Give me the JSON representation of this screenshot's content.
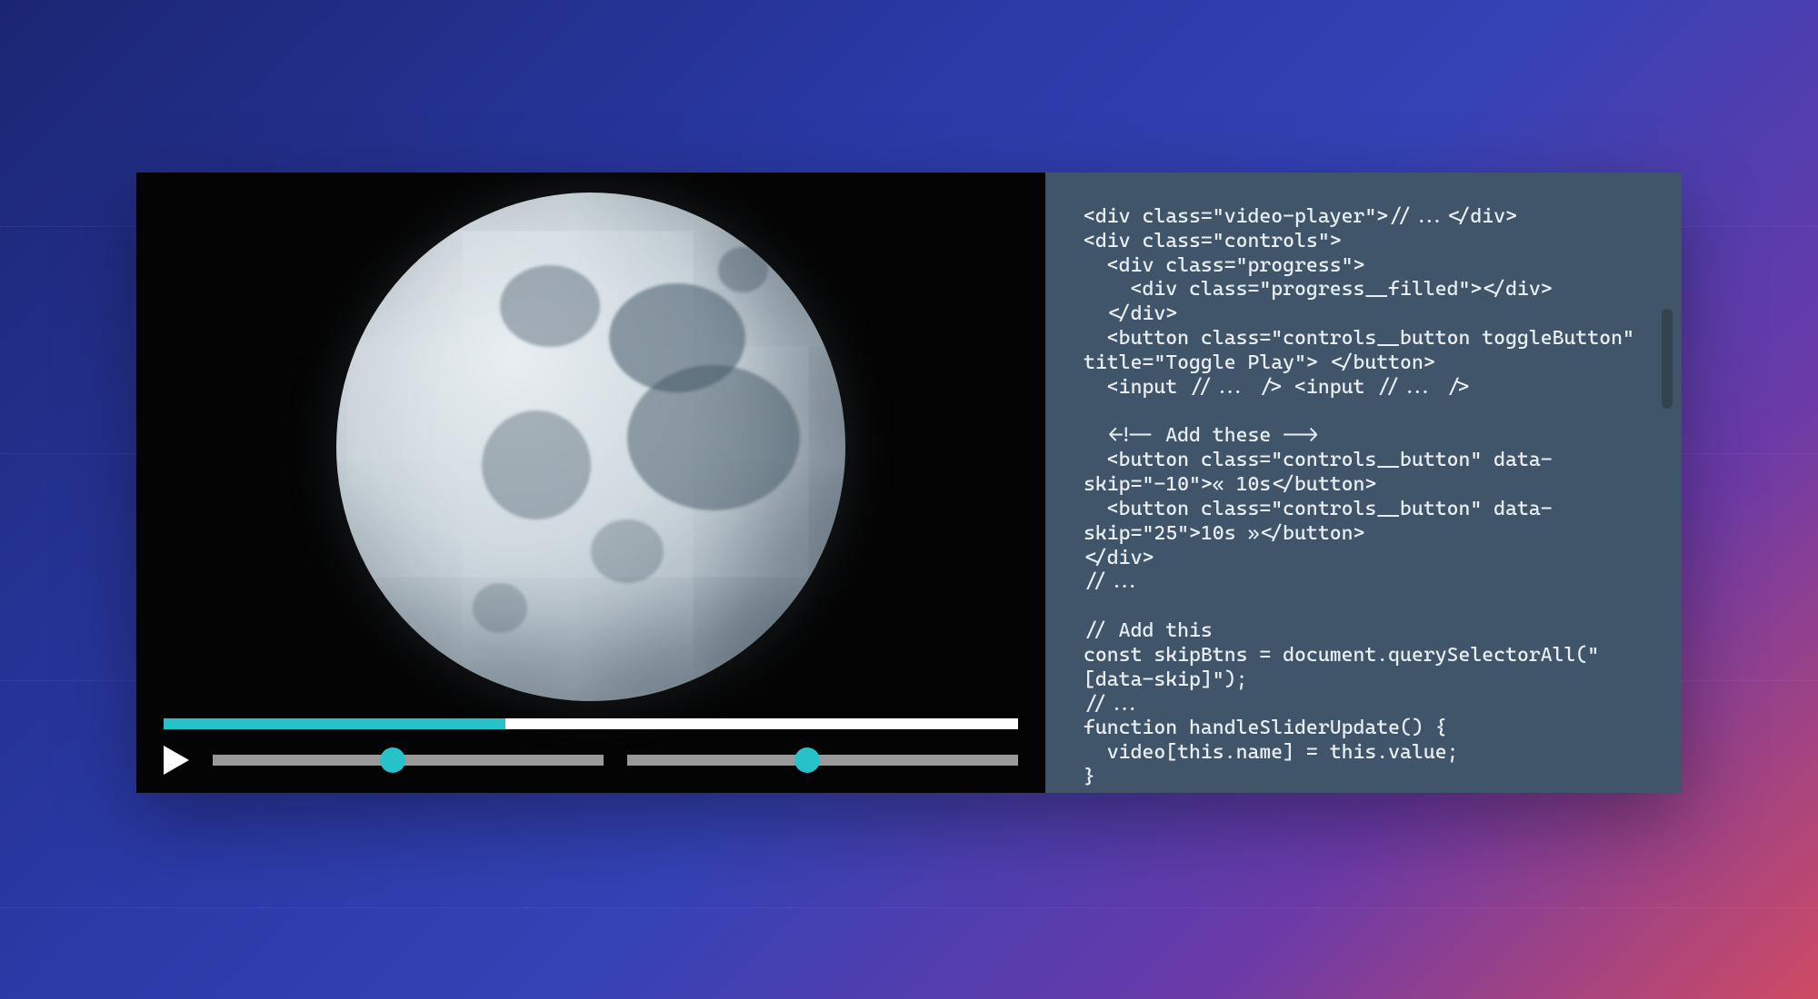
{
  "player": {
    "progress_percent": 40,
    "slider1_percent": 46,
    "slider2_percent": 46
  },
  "code": {
    "lines": [
      "<div class=\"video-player\">//...</div>",
      "<div class=\"controls\">",
      "  <div class=\"progress\">",
      "    <div class=\"progress__filled\"></div>",
      "  </div>",
      "  <button class=\"controls__button toggleButton\" title=\"Toggle Play\"> </button>",
      "  <input //... /> <input //... />",
      "",
      "  <!-- Add these -->",
      "  <button class=\"controls__button\" data-skip=\"-10\">« 10s</button>",
      "  <button class=\"controls__button\" data-skip=\"25\">10s »</button>",
      "</div>",
      "//...",
      "",
      "// Add this",
      "const skipBtns = document.querySelectorAll(\"[data-skip]\");",
      "//...",
      "function handleSliderUpdate() {",
      "  video[this.name] = this.value;",
      "}"
    ]
  },
  "colors": {
    "accent": "#26c1c9",
    "code_bg": "#40556a",
    "code_fg": "#e9eef2"
  }
}
